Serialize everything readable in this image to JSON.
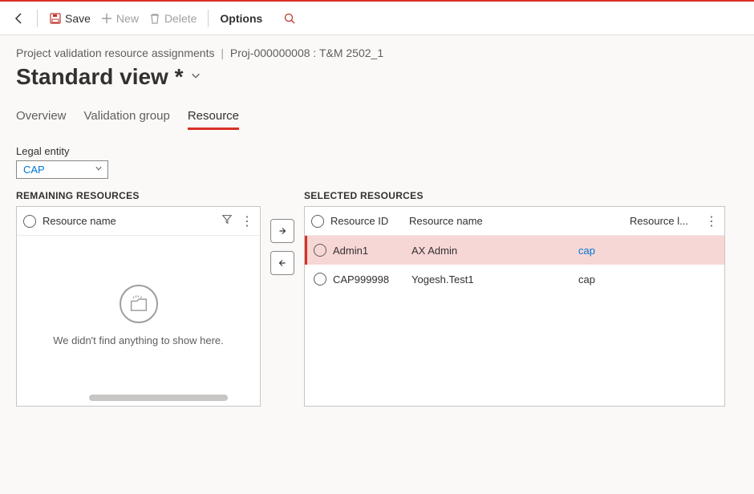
{
  "toolbar": {
    "save_label": "Save",
    "new_label": "New",
    "delete_label": "Delete",
    "options_label": "Options"
  },
  "breadcrumb": {
    "page": "Project validation resource assignments",
    "context": "Proj-000000008 : T&M 2502_1"
  },
  "title": "Standard view *",
  "tabs": {
    "overview": "Overview",
    "validation_group": "Validation group",
    "resource": "Resource"
  },
  "legal_entity": {
    "label": "Legal entity",
    "value": "CAP"
  },
  "remaining": {
    "title": "REMAINING RESOURCES",
    "col_name": "Resource name",
    "empty_msg": "We didn't find anything to show here."
  },
  "selected": {
    "title": "SELECTED RESOURCES",
    "col_id": "Resource ID",
    "col_name": "Resource name",
    "col_legal": "Resource l...",
    "rows": [
      {
        "id": "Admin1",
        "name": "AX Admin",
        "legal": "cap",
        "highlight": true,
        "legal_link": true
      },
      {
        "id": "CAP999998",
        "name": "Yogesh.Test1",
        "legal": "cap",
        "highlight": false,
        "legal_link": false
      }
    ]
  }
}
